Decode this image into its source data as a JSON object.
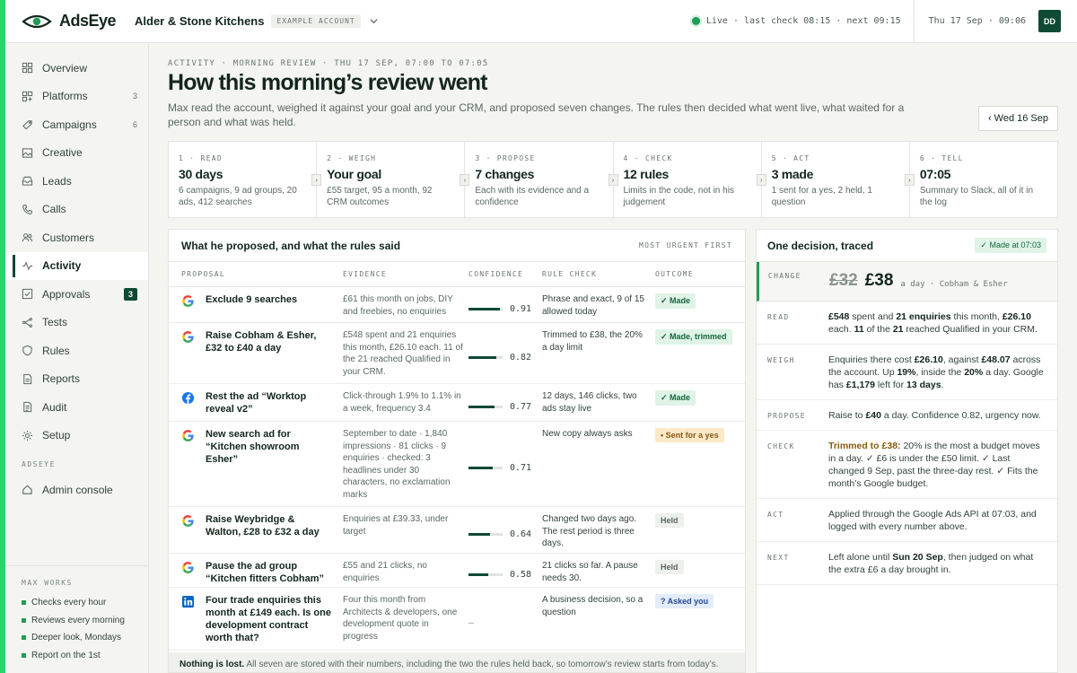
{
  "brand": {
    "name": "AdsEye"
  },
  "account": {
    "name": "Alder & Stone Kitchens",
    "badge": "EXAMPLE ACCOUNT"
  },
  "status": {
    "live_text": "Live · last check 08:15 · next 09:15",
    "clock": "Thu 17 Sep · 09:06",
    "avatar": "DD"
  },
  "sidebar": {
    "items": [
      {
        "label": "Overview",
        "count": ""
      },
      {
        "label": "Platforms",
        "count": "3"
      },
      {
        "label": "Campaigns",
        "count": "6"
      },
      {
        "label": "Creative",
        "count": ""
      },
      {
        "label": "Leads",
        "count": ""
      },
      {
        "label": "Calls",
        "count": ""
      },
      {
        "label": "Customers",
        "count": ""
      },
      {
        "label": "Activity",
        "count": ""
      },
      {
        "label": "Approvals",
        "count": "3"
      },
      {
        "label": "Tests",
        "count": ""
      },
      {
        "label": "Rules",
        "count": ""
      },
      {
        "label": "Reports",
        "count": ""
      },
      {
        "label": "Audit",
        "count": ""
      },
      {
        "label": "Setup",
        "count": ""
      }
    ],
    "section_label": "ADSEYE",
    "admin_label": "Admin console",
    "max_works": {
      "title": "MAX WORKS",
      "items": [
        "Checks every hour",
        "Reviews every morning",
        "Deeper look, Mondays",
        "Report on the 1st"
      ]
    }
  },
  "main": {
    "eyebrow": "ACTIVITY · MORNING REVIEW · THU 17 SEP, 07:00 TO 07:05",
    "title": "How this morning’s review went",
    "intro": "Max read the account, weighed it against your goal and your CRM, and proposed seven changes. The rules then decided what went live, what waited for a person and what was held.",
    "prev_button": "‹ Wed 16 Sep",
    "steps": [
      {
        "label": "1 · READ",
        "value": "30 days",
        "desc": "6 campaigns, 9 ad groups, 20 ads, 412 searches"
      },
      {
        "label": "2 · WEIGH",
        "value": "Your goal",
        "desc": "£55 target, 95 a month, 92 CRM outcomes"
      },
      {
        "label": "3 · PROPOSE",
        "value": "7 changes",
        "desc": "Each with its evidence and a confidence"
      },
      {
        "label": "4 · CHECK",
        "value": "12 rules",
        "desc": "Limits in the code, not in his judgement"
      },
      {
        "label": "5 · ACT",
        "value": "3 made",
        "desc": "1 sent for a yes, 2 held, 1 question"
      },
      {
        "label": "6 · TELL",
        "value": "07:05",
        "desc": "Summary to Slack, all of it in the log"
      }
    ],
    "step_arrow": "›"
  },
  "proposals": {
    "title": "What he proposed, and what the rules said",
    "sort": "MOST URGENT FIRST",
    "columns": [
      "PROPOSAL",
      "EVIDENCE",
      "CONFIDENCE",
      "RULE CHECK",
      "OUTCOME"
    ],
    "rows": [
      {
        "platform": "google-icon",
        "proposal": "Exclude 9 searches",
        "evidence": "£61 this month on jobs, DIY and freebies, no enquiries",
        "confidence": 0.91,
        "confidence_text": "0.91",
        "rule": "Phrase and exact, 9 of 15 allowed today",
        "outcome": "✓ Made",
        "kind": "made"
      },
      {
        "platform": "google-icon",
        "proposal": "Raise Cobham & Esher, £32 to £40 a day",
        "evidence": "£548 spent and 21 enquiries this month, £26.10 each. 11 of the 21 reached Qualified in your CRM.",
        "confidence": 0.82,
        "confidence_text": "0.82",
        "rule": "Trimmed to £38, the 20% a day limit",
        "outcome": "✓ Made, trimmed",
        "kind": "made"
      },
      {
        "platform": "facebook-icon",
        "proposal": "Rest the ad “Worktop reveal v2”",
        "evidence": "Click-through 1.9% to 1.1% in a week, frequency 3.4",
        "confidence": 0.77,
        "confidence_text": "0.77",
        "rule": "12 days, 146 clicks, two ads stay live",
        "outcome": "✓ Made",
        "kind": "made"
      },
      {
        "platform": "google-icon",
        "proposal": "New search ad for “Kitchen showroom Esher”",
        "evidence": "September to date · 1,840 impressions · 81 clicks · 9 enquiries · checked: 3 headlines under 30 characters, no exclamation marks",
        "confidence": 0.71,
        "confidence_text": "0.71",
        "rule": "New copy always asks",
        "outcome": "• Sent for a yes",
        "kind": "sent"
      },
      {
        "platform": "google-icon",
        "proposal": "Raise Weybridge & Walton, £28 to £32 a day",
        "evidence": "Enquiries at £39.33, under target",
        "confidence": 0.64,
        "confidence_text": "0.64",
        "rule": "Changed two days ago. The rest period is three days.",
        "outcome": "Held",
        "kind": "held"
      },
      {
        "platform": "google-icon",
        "proposal": "Pause the ad group “Kitchen fitters Cobham”",
        "evidence": "£55 and 21 clicks, no enquiries",
        "confidence": 0.58,
        "confidence_text": "0.58",
        "rule": "21 clicks so far. A pause needs 30.",
        "outcome": "Held",
        "kind": "held"
      },
      {
        "platform": "linkedin-icon",
        "proposal": "Four trade enquiries this month at £149 each. Is one development contract worth that?",
        "evidence": "Four this month from Architects & developers, one development quote in progress",
        "confidence": null,
        "confidence_text": "–",
        "rule": "A business decision, so a question",
        "outcome": "? Asked you",
        "kind": "asked"
      }
    ],
    "footnote_bold": "Nothing is lost.",
    "footnote_rest": " All seven are stored with their numbers, including the two the rules held back, so tomorrow’s review starts from today’s."
  },
  "trace": {
    "title": "One decision, traced",
    "badge": "✓ Made at 07:03",
    "change_label": "CHANGE",
    "old_value": "£32",
    "new_value": "£38",
    "unit": "a day · Cobham & Esher",
    "rows": [
      {
        "label": "READ",
        "html": "<b>£548</b> spent and <b>21 enquiries</b> this month, <b>£26.10</b> each. <b>11</b> of the <b>21</b> reached Qualified in your CRM."
      },
      {
        "label": "WEIGH",
        "html": "Enquiries there cost <b>£26.10</b>, against <b>£48.07</b> across the account. Up <b>19%</b>, inside the <b>20%</b> a day. Google has <b>£1,179</b> left for <b>13 days</b>."
      },
      {
        "label": "PROPOSE",
        "html": "Raise to <b>£40</b> a day. Confidence 0.82, urgency now."
      },
      {
        "label": "CHECK",
        "html": "<span class=\"amber\">Trimmed to £38:</span> 20% is the most a budget moves in a day. ✓ £6 is under the £50 limit. ✓ Last changed 9 Sep, past the three-day rest. ✓ Fits the month’s Google budget."
      },
      {
        "label": "ACT",
        "html": "Applied through the Google Ads API at 07:03, and logged with every number above."
      },
      {
        "label": "NEXT",
        "html": "Left alone until <b>Sun 20 Sep</b>, then judged on what the extra £6 a day brought in."
      }
    ]
  }
}
